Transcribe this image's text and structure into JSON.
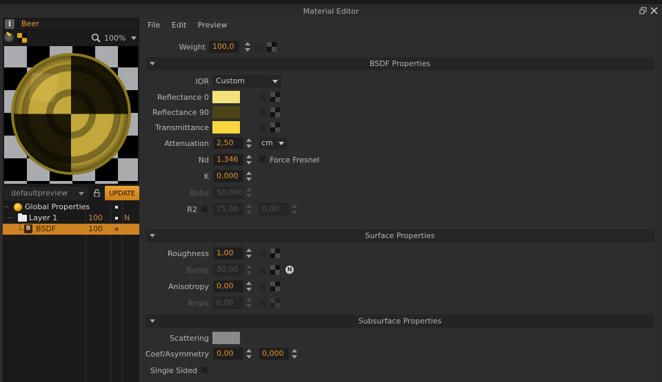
{
  "window": {
    "title": "Material Editor",
    "restore_icon": "restore-icon",
    "close_icon": "close-icon"
  },
  "left_panel": {
    "material_name": "Beer",
    "zoom": "100%",
    "preset": "defaultpreview",
    "update_label": "UPDATE",
    "tree": [
      {
        "label": "Global Properties",
        "icon": "sphere-icon",
        "value": "",
        "flag": ""
      },
      {
        "label": "Layer 1",
        "icon": "folder-icon",
        "value": "100",
        "flag": "N"
      },
      {
        "label": "BSDF",
        "icon": "bsdf-icon",
        "icon_letter": "B",
        "value": "100",
        "flag": "",
        "selected": true
      }
    ]
  },
  "menu": [
    "File",
    "Edit",
    "Preview"
  ],
  "weight": {
    "label": "Weight",
    "value": "100,0"
  },
  "sections": {
    "bsdf": {
      "title": "BSDF Properties",
      "ior_label": "IOR",
      "ior_value": "Custom",
      "reflectance0": {
        "label": "Reflectance 0",
        "color": "#f3e27a"
      },
      "reflectance90": {
        "label": "Reflectance 90",
        "color": "#4b4414"
      },
      "transmittance": {
        "label": "Transmittance",
        "color": "#fcd640"
      },
      "attenuation": {
        "label": "Attenuation",
        "value": "2,50",
        "unit": "cm"
      },
      "nd": {
        "label": "Nd",
        "value": "1,346"
      },
      "force_fresnel": {
        "label": "Force Fresnel",
        "checked": false
      },
      "k": {
        "label": "K",
        "value": "0,000"
      },
      "abbe": {
        "label": "Abbe",
        "value": "50,000",
        "disabled": true
      },
      "r2": {
        "label": "R2",
        "value1": "75,00",
        "value2": "0,00",
        "checked": false
      }
    },
    "surface": {
      "title": "Surface Properties",
      "roughness": {
        "label": "Roughness",
        "value": "1,00"
      },
      "bump": {
        "label": "Bump",
        "value": "30,00",
        "disabled": true,
        "badge": "N"
      },
      "anisotropy": {
        "label": "Anisotropy",
        "value": "0,00"
      },
      "angle": {
        "label": "Angle",
        "value": "0,00",
        "disabled": true
      }
    },
    "subsurface": {
      "title": "Subsurface Properties",
      "scattering": {
        "label": "Scattering",
        "color": "#8a8a8a"
      },
      "coef": {
        "label": "Coef/Asymmetry",
        "value1": "0,00",
        "value2": "0,000"
      },
      "single_sided": {
        "label": "Single Sided",
        "checked": false
      }
    }
  }
}
